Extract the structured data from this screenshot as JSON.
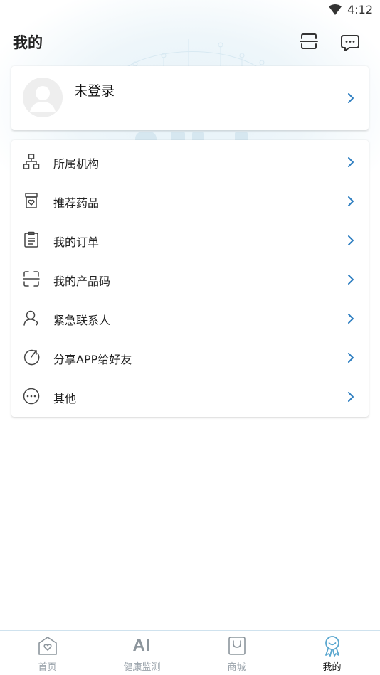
{
  "status_bar": {
    "time": "4:12"
  },
  "header": {
    "title": "我的"
  },
  "profile": {
    "name": "未登录"
  },
  "menu": {
    "items": [
      {
        "label": "所属机构",
        "icon": "org-chart-icon"
      },
      {
        "label": "推荐药品",
        "icon": "medicine-icon"
      },
      {
        "label": "我的订单",
        "icon": "order-clipboard-icon"
      },
      {
        "label": "我的产品码",
        "icon": "product-code-icon"
      },
      {
        "label": "紧急联系人",
        "icon": "emergency-contact-icon"
      },
      {
        "label": "分享APP给好友",
        "icon": "share-icon"
      },
      {
        "label": "其他",
        "icon": "more-icon"
      }
    ]
  },
  "tabs": [
    {
      "label": "首页",
      "icon": "home-icon",
      "active": false
    },
    {
      "label": "健康监测",
      "icon": "ai-icon",
      "icon_text": "AI",
      "active": false
    },
    {
      "label": "商城",
      "icon": "shop-bag-icon",
      "active": false
    },
    {
      "label": "我的",
      "icon": "profile-icon",
      "active": true
    }
  ],
  "colors": {
    "accent": "#3a87c8",
    "chevron": "#2f7fc1",
    "tab_inactive": "#9aa3ab",
    "tab_active_icon": "#5aa7cf"
  }
}
